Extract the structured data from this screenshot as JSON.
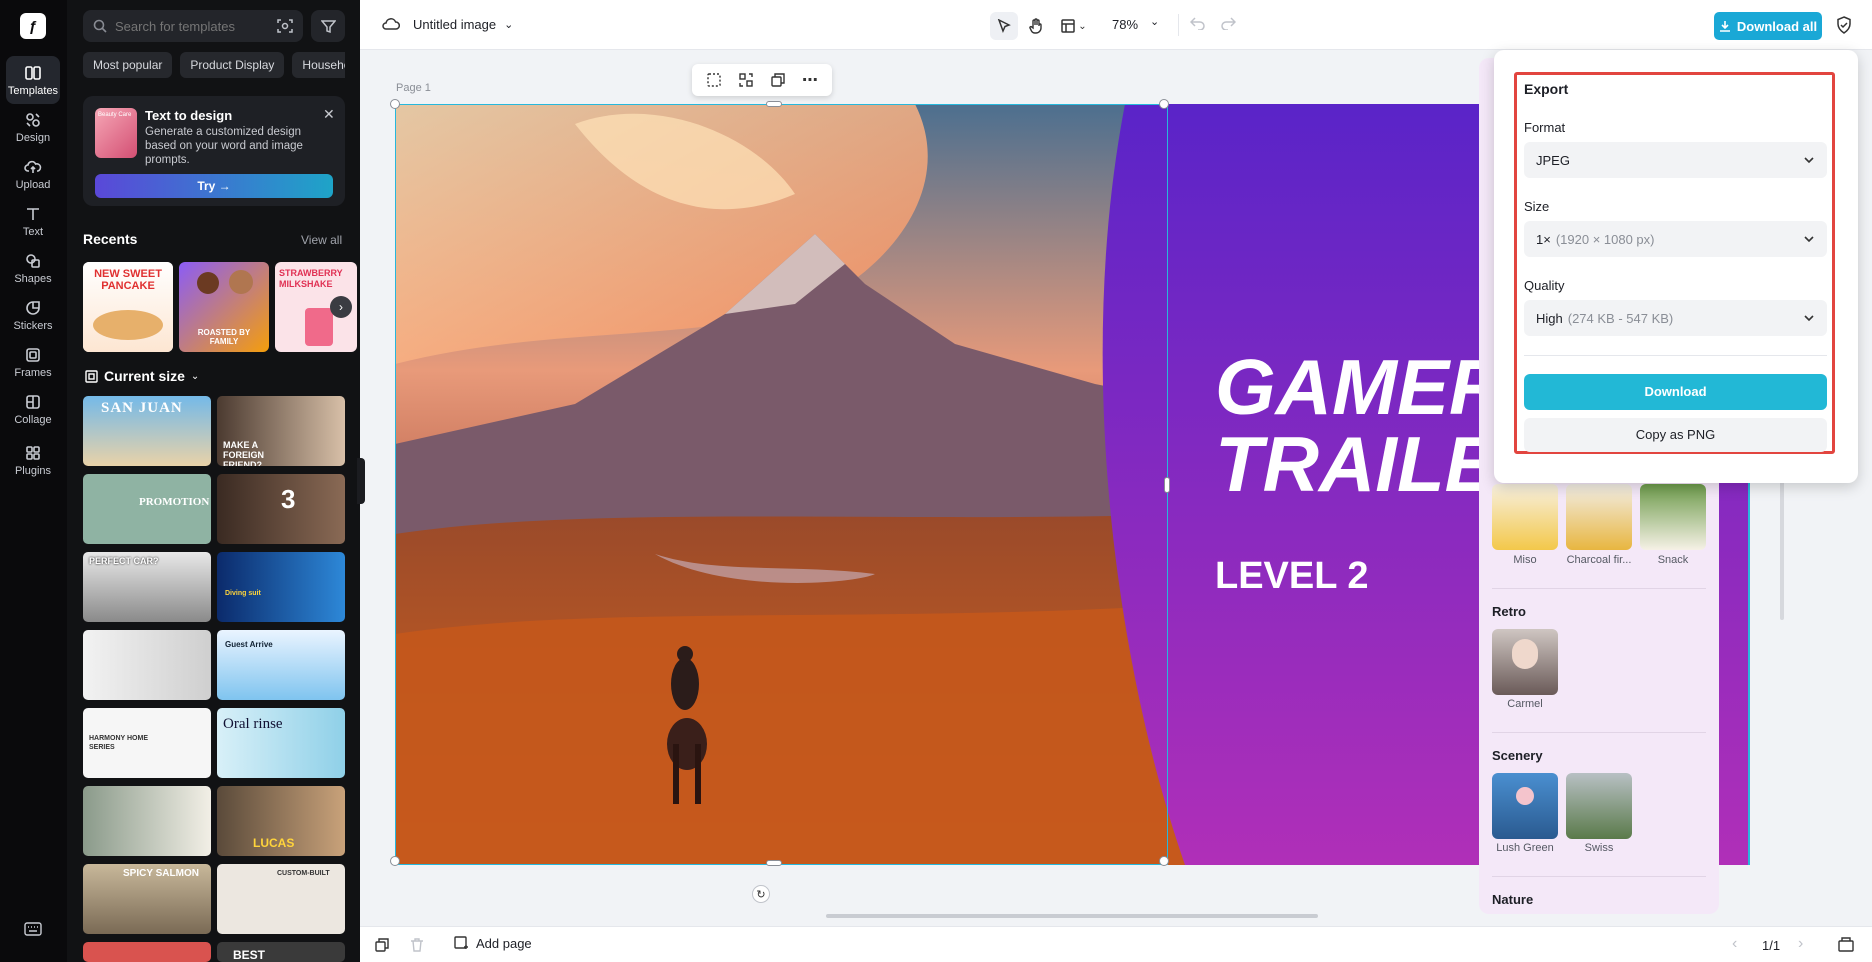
{
  "rail": {
    "items": [
      {
        "label": "Templates",
        "icon": "templates-icon"
      },
      {
        "label": "Design",
        "icon": "design-icon"
      },
      {
        "label": "Upload",
        "icon": "upload-icon"
      },
      {
        "label": "Text",
        "icon": "text-icon"
      },
      {
        "label": "Shapes",
        "icon": "shapes-icon"
      },
      {
        "label": "Stickers",
        "icon": "stickers-icon"
      },
      {
        "label": "Frames",
        "icon": "frames-icon"
      },
      {
        "label": "Collage",
        "icon": "collage-icon"
      },
      {
        "label": "Plugins",
        "icon": "plugins-icon"
      }
    ]
  },
  "panel": {
    "search_placeholder": "Search for templates",
    "chips": [
      "Most popular",
      "Product Display",
      "Househo"
    ],
    "promo": {
      "title": "Text to design",
      "description": "Generate a customized design based on your word and image prompts.",
      "badge": "Beauty Care",
      "try_label": "Try →"
    },
    "recents": {
      "title": "Recents",
      "view_all": "View all",
      "items": [
        {
          "text": "NEW SWEET PANCAKE"
        },
        {
          "text": "ROASTED BY FAMILY"
        },
        {
          "text": "STRAWBERRY MILKSHAKE"
        }
      ]
    },
    "current_size": {
      "title": "Current size",
      "templates": [
        {
          "text": "SAN JUAN"
        },
        {
          "text": "MAKE A FOREIGN FRIEND?"
        },
        {
          "text": "PROMOTION"
        },
        {
          "text": "3"
        },
        {
          "text": "PERFECT CAR?"
        },
        {
          "text": "Diving suit"
        },
        {
          "text": ""
        },
        {
          "text": "Guest Arrive"
        },
        {
          "text": "HARMONY HOME SERIES"
        },
        {
          "text": "Oral rinse"
        },
        {
          "text": ""
        },
        {
          "text": "LUCAS"
        },
        {
          "text": "SPICY SALMON"
        },
        {
          "text": "CUSTOM-BUILT"
        },
        {
          "text": ""
        },
        {
          "text": "BEST"
        }
      ]
    }
  },
  "topbar": {
    "title": "Untitled image",
    "zoom": "78%",
    "download_all": "Download all"
  },
  "canvas": {
    "page_label": "Page 1",
    "headline_line1": "GAMER",
    "headline_line2": "TRAILER",
    "subheadline": "LEVEL 2"
  },
  "style_panel": {
    "sections": [
      {
        "title": "Retro",
        "items": [
          {
            "label": "Carmel"
          }
        ]
      },
      {
        "title": "Scenery",
        "items": [
          {
            "label": "Lush Green"
          },
          {
            "label": "Swiss"
          }
        ]
      },
      {
        "title": "Nature",
        "items": []
      }
    ],
    "top_items": [
      {
        "label": "Miso"
      },
      {
        "label": "Charcoal fir..."
      },
      {
        "label": "Snack"
      }
    ]
  },
  "export": {
    "title": "Export",
    "format_label": "Format",
    "format_value": "JPEG",
    "size_label": "Size",
    "size_value": "1×",
    "size_detail": "(1920 × 1080 px)",
    "quality_label": "Quality",
    "quality_value": "High",
    "quality_detail": "(274 KB - 547 KB)",
    "download_label": "Download",
    "copy_label": "Copy as PNG"
  },
  "bottombar": {
    "add_page": "Add page",
    "page_count": "1/1"
  },
  "colors": {
    "accent": "#22b8d6",
    "export_outline": "#e2453f",
    "purple": "#6a22c8"
  }
}
